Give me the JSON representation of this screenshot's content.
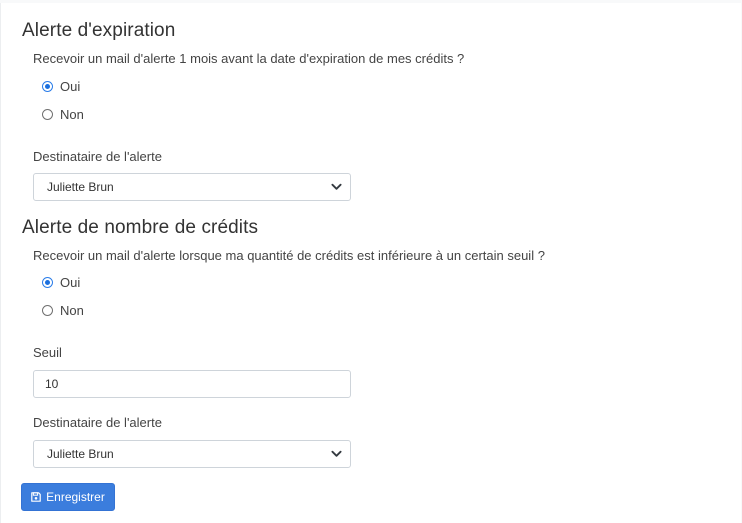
{
  "expiration": {
    "title": "Alerte d'expiration",
    "question": "Recevoir un mail d'alerte 1 mois avant la date d'expiration de mes crédits ?",
    "options": [
      {
        "label": "Oui",
        "checked": true
      },
      {
        "label": "Non",
        "checked": false
      }
    ],
    "recipient_label": "Destinataire de l'alerte",
    "recipient_value": "Juliette Brun"
  },
  "credits": {
    "title": "Alerte de nombre de crédits",
    "question": "Recevoir un mail d'alerte lorsque ma quantité de crédits est inférieure à un certain seuil ?",
    "options": [
      {
        "label": "Oui",
        "checked": true
      },
      {
        "label": "Non",
        "checked": false
      }
    ],
    "threshold_label": "Seuil",
    "threshold_value": "10",
    "recipient_label": "Destinataire de l'alerte",
    "recipient_value": "Juliette Brun"
  },
  "actions": {
    "save_label": "Enregistrer",
    "save_icon": "floppy-disk-icon"
  },
  "colors": {
    "accent": "#3b7ddd",
    "radio_checked": "#1b6fde"
  }
}
